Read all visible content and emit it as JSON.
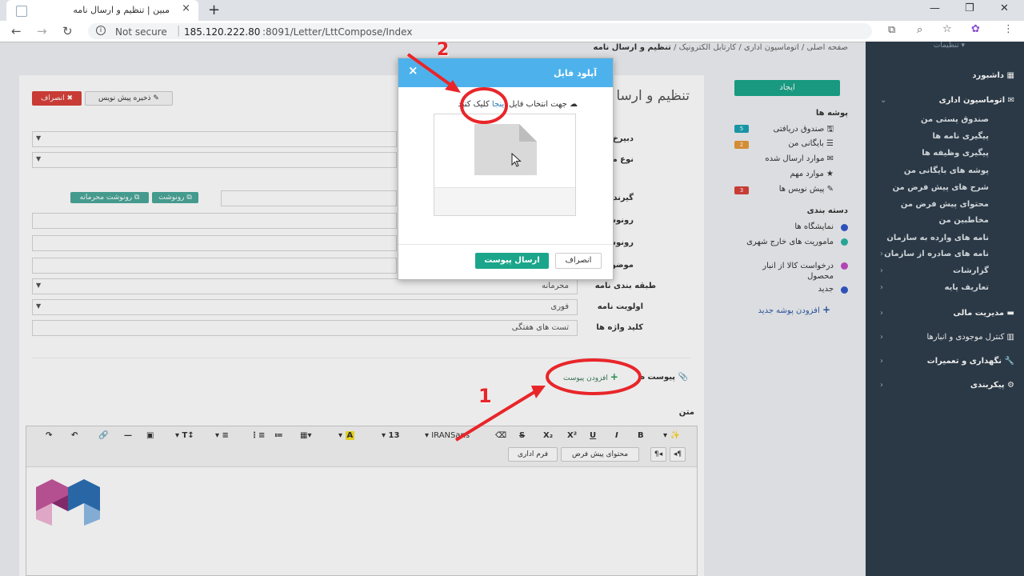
{
  "browser": {
    "tab_title": "مبین | تنظیم و ارسال نامه",
    "new_tab": "+",
    "not_secure": "Not secure",
    "url_host": "185.120.222.80",
    "url_path": ":8091/Letter/LttCompose/Index"
  },
  "breadcrumb": {
    "home": "صفحه اصلی",
    "office": "اتوماسیون اداری",
    "cartable": "کارتابل الکترونیک",
    "current": "تنظیم و ارسال نامه",
    "sep": "/"
  },
  "compose": {
    "title_partial": "تنظیم و ارسا",
    "draft_button": "ذخیره پیش نویس",
    "cancel_button": "انصراف",
    "label_secretariat": "دبیرخ",
    "label_lettertype": "نوع مک",
    "label_recipients": "گیرند",
    "label_cc": "رونوش",
    "label_cc_private": "رونوشت محرم",
    "label_subject": "موضوع (انتخا",
    "label_classification": "طبقه بندی نامه",
    "label_priority": "اولویت نامه",
    "label_keywords": "کلید واژه ها",
    "cc_button": "رونوشت",
    "cc_private_button": "رونوشت محرمانه",
    "classification_value": "محرمانه",
    "priority_value": "فوری",
    "keywords_value": "تست های هفتگی",
    "attachments_label": "پیوست ه",
    "add_attachment": "افزودن پیوست",
    "body_label": "متن",
    "font_name": "IRANSans",
    "font_size": "13",
    "default_content_button": "محتوای پیش فرض",
    "office_form_button": "فرم اداری"
  },
  "folders": {
    "create_button": "ایجاد",
    "folders_heading": "پوشه ها",
    "inbox": "صندوق دریافتی",
    "inbox_count": "5",
    "archive": "بایگانی من",
    "archive_count": "2",
    "sent": "موارد ارسال شده",
    "important": "موارد مهم",
    "drafts": "پیش نویس ها",
    "drafts_count": "3",
    "categories_heading": "دسته بندی",
    "cat_exhibitions": "نمایشگاه ها",
    "cat_missions": "ماموریت های خارج شهری",
    "cat_request": "درخواست کالا از انبار محصول",
    "cat_new": "جدید",
    "add_folder": "افزودن پوشه جدید"
  },
  "sidebar": {
    "settings": "تنظیمات",
    "dashboard": "داشبورد",
    "office_automation": "اتوماسیون اداری",
    "items": [
      "صندوق پستی من",
      "پیگیری نامه ها",
      "پیگیری وظیفه ها",
      "پوشه های بایگانی من",
      "شرح های پیش فرض من",
      "محتوای پیش فرض من",
      "مخاطبین من",
      "نامه های وارده به سازمان",
      "نامه های صادره از سازمان",
      "گزارشات",
      "تعاریف پایه"
    ],
    "financial": "مدیریت مالی",
    "inventory": "کنترل موجودی و انبارها",
    "maintenance": "نگهداری و تعمیرات",
    "configuration": "پیکربندی"
  },
  "modal": {
    "title": "آپلود فایل",
    "close": "×",
    "hint_before": "جهت انتخاب فایل ",
    "hint_link": "اینجا",
    "hint_after": " کلیک کنید",
    "send_button": "ارسال پیوست",
    "cancel_button": "انصراف"
  },
  "annotations": {
    "step1": "1",
    "step2": "2"
  },
  "colors": {
    "sidebar_bg": "#2f3e4c",
    "accent_green": "#1ba68b",
    "danger_red": "#d9423a",
    "modal_header": "#4db2ec",
    "annotation_red": "#e8262a"
  }
}
